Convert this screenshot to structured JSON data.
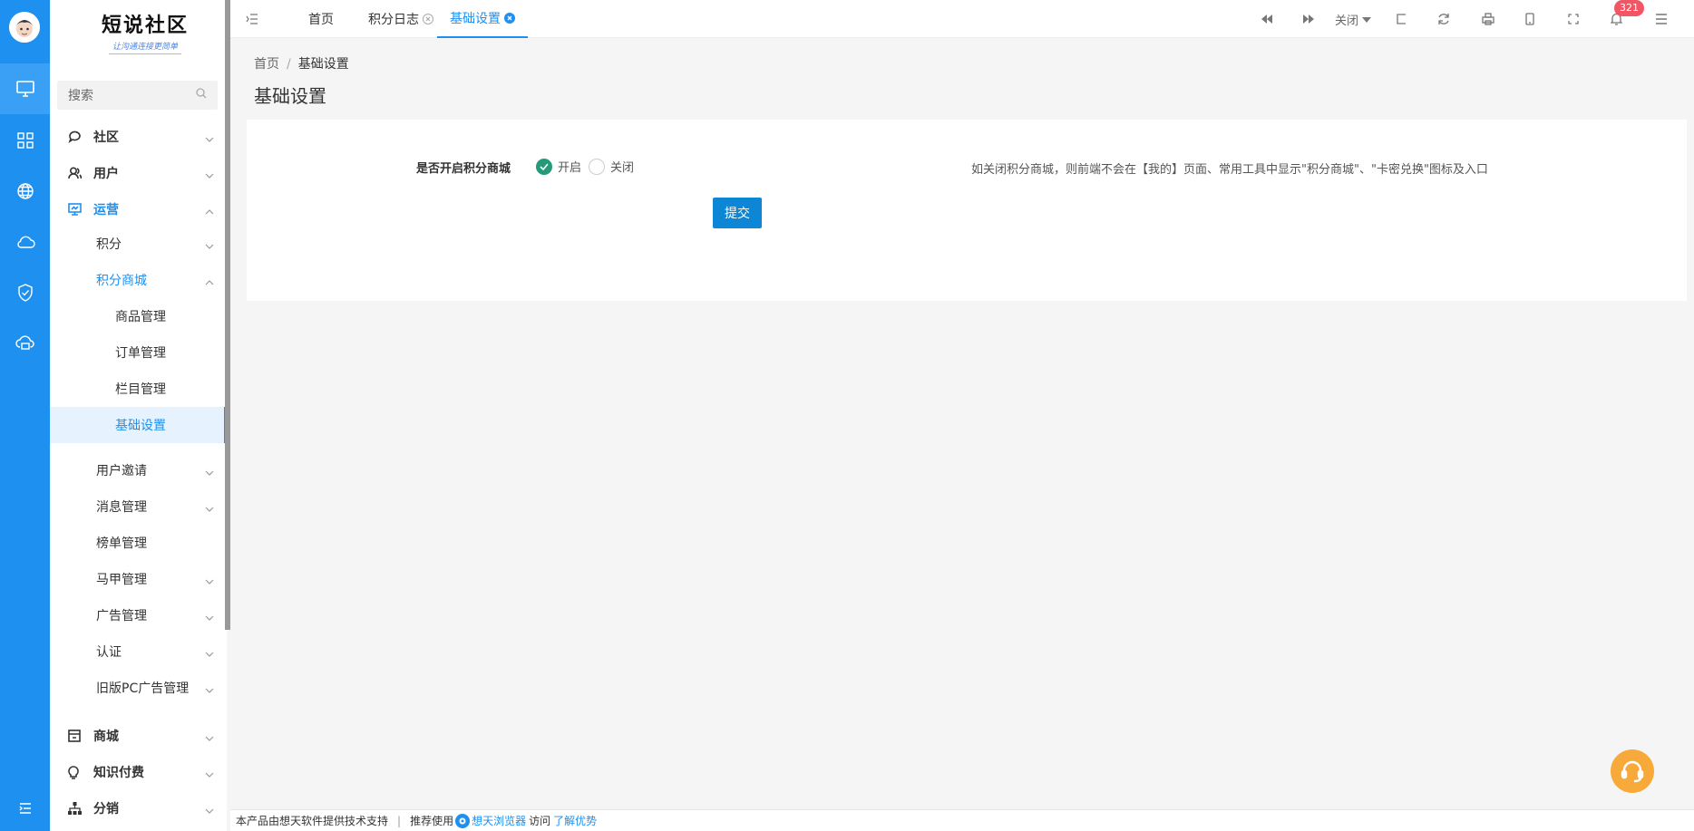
{
  "logo": {
    "title": "短说社区",
    "subtitle": "让沟通连接更简单"
  },
  "search": {
    "placeholder": "搜索"
  },
  "rail": {
    "icons": [
      "monitor-icon",
      "grid-icon",
      "globe-icon",
      "cloud-icon",
      "shield-check-icon",
      "cloud-print-icon"
    ],
    "bottom_icon": "menu-collapse-icon"
  },
  "sidebar": {
    "items": [
      {
        "label": "社区",
        "level": 0,
        "icon": "chat-icon"
      },
      {
        "label": "用户",
        "level": 0,
        "icon": "users-icon"
      },
      {
        "label": "运营",
        "level": 0,
        "icon": "presentation-icon",
        "expanded": true
      },
      {
        "label": "积分",
        "level": 1
      },
      {
        "label": "积分商城",
        "level": 1,
        "expanded": true
      },
      {
        "label": "商品管理",
        "level": 2
      },
      {
        "label": "订单管理",
        "level": 2
      },
      {
        "label": "栏目管理",
        "level": 2
      },
      {
        "label": "基础设置",
        "level": 2,
        "selected": true
      },
      {
        "label": "用户邀请",
        "level": 1
      },
      {
        "label": "消息管理",
        "level": 1
      },
      {
        "label": "榜单管理",
        "level": 1
      },
      {
        "label": "马甲管理",
        "level": 1
      },
      {
        "label": "广告管理",
        "level": 1
      },
      {
        "label": "认证",
        "level": 1
      },
      {
        "label": "旧版PC广告管理",
        "level": 1
      },
      {
        "label": "商城",
        "level": 0,
        "icon": "store-icon"
      },
      {
        "label": "知识付费",
        "level": 0,
        "icon": "bulb-icon"
      },
      {
        "label": "分销",
        "level": 0,
        "icon": "sitemap-icon"
      }
    ]
  },
  "tabs": [
    {
      "label": "首页",
      "closable": false
    },
    {
      "label": "积分日志",
      "closable": true
    },
    {
      "label": "基础设置",
      "closable": true,
      "active": true
    }
  ],
  "toolbar": {
    "close_label": "关闭",
    "notification_count": "321"
  },
  "breadcrumb": {
    "home": "首页",
    "current": "基础设置"
  },
  "page": {
    "title": "基础设置"
  },
  "form": {
    "label": "是否开启积分商城",
    "option_on": "开启",
    "option_off": "关闭",
    "selected": "开启",
    "hint": "如关闭积分商城，则前端不会在【我的】页面、常用工具中显示\"积分商城\"、\"卡密兑换\"图标及入口",
    "submit": "提交"
  },
  "footer": {
    "text1": "本产品由想天软件提供技术支持",
    "sep": "|",
    "text2": "推荐使用",
    "browser": "想天浏览器",
    "text3": "访问",
    "link": "了解优势"
  },
  "colors": {
    "primary": "#1e90f0",
    "success": "#259a78",
    "badge": "#f25563",
    "fab": "#f7a93a"
  }
}
